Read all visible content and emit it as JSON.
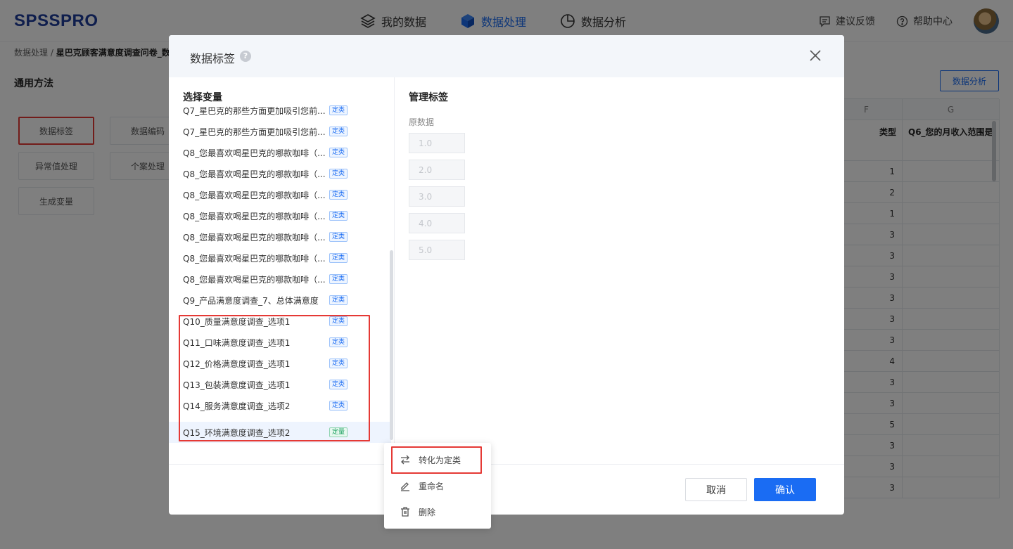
{
  "app": {
    "logo": "SPSSPRO"
  },
  "nav": [
    {
      "label": "我的数据",
      "icon": "layers-icon"
    },
    {
      "label": "数据处理",
      "icon": "cube-icon",
      "active": true
    },
    {
      "label": "数据分析",
      "icon": "pie-chart-icon"
    }
  ],
  "tools": {
    "feedback": "建议反馈",
    "help": "帮助中心"
  },
  "breadcrumb": {
    "root": "数据处理 / ",
    "current": "星巴克顾客满意度调查问卷_数"
  },
  "methods": {
    "title": "通用方法",
    "items": [
      "数据标签",
      "数据编码",
      "异常值处理",
      "个案处理",
      "生成变量"
    ],
    "selected": "数据标签"
  },
  "analysis_button": "数据分析",
  "grid": {
    "col_f": {
      "header": "F",
      "name": "类型"
    },
    "col_g": {
      "header": "G",
      "name": "Q6_您的月收入范围是"
    },
    "values_f": [
      "1",
      "2",
      "1",
      "3",
      "3",
      "3",
      "3",
      "3",
      "3",
      "4",
      "3",
      "3",
      "5",
      "3",
      "3",
      "3"
    ]
  },
  "modal": {
    "title": "数据标签",
    "help_icon": "help-circle-icon",
    "left_title": "选择变量",
    "right_title": "管理标签",
    "variables": [
      {
        "name": "Q7_星巴克的那些方面更加吸引您前...",
        "tag": "定类"
      },
      {
        "name": "Q7_星巴克的那些方面更加吸引您前...",
        "tag": "定类"
      },
      {
        "name": "Q8_您最喜欢喝星巴克的哪款咖啡（...",
        "tag": "定类"
      },
      {
        "name": "Q8_您最喜欢喝星巴克的哪款咖啡（...",
        "tag": "定类"
      },
      {
        "name": "Q8_您最喜欢喝星巴克的哪款咖啡（...",
        "tag": "定类"
      },
      {
        "name": "Q8_您最喜欢喝星巴克的哪款咖啡（...",
        "tag": "定类"
      },
      {
        "name": "Q8_您最喜欢喝星巴克的哪款咖啡（...",
        "tag": "定类"
      },
      {
        "name": "Q8_您最喜欢喝星巴克的哪款咖啡（...",
        "tag": "定类"
      },
      {
        "name": "Q8_您最喜欢喝星巴克的哪款咖啡（...",
        "tag": "定类"
      },
      {
        "name": "Q9_产品满意度调查_7、总体满意度",
        "tag": "定类"
      },
      {
        "name": "Q10_质量满意度调查_选项1",
        "tag": "定类"
      },
      {
        "name": "Q11_口味满意度调查_选项1",
        "tag": "定类"
      },
      {
        "name": "Q12_价格满意度调查_选项1",
        "tag": "定类"
      },
      {
        "name": "Q13_包装满意度调查_选项1",
        "tag": "定类"
      },
      {
        "name": "Q14_服务满意度调查_选项2",
        "tag": "定类"
      },
      {
        "name": "Q15_环境满意度调查_选项2",
        "tag": "定量",
        "selected": true
      }
    ],
    "original_label": "原数据",
    "original_values": [
      "1.0",
      "2.0",
      "3.0",
      "4.0",
      "5.0"
    ],
    "cancel": "取消",
    "ok": "确认"
  },
  "context_menu": [
    {
      "label": "转化为定类",
      "icon": "swap-arrows-icon"
    },
    {
      "label": "重命名",
      "icon": "edit-pen-icon"
    },
    {
      "label": "删除",
      "icon": "trash-icon"
    }
  ],
  "colors": {
    "primary": "#1a6cf3",
    "highlight_border": "#e53935",
    "categorical_tag": "#1a6cf3",
    "quantitative_tag": "#1aa05f"
  }
}
